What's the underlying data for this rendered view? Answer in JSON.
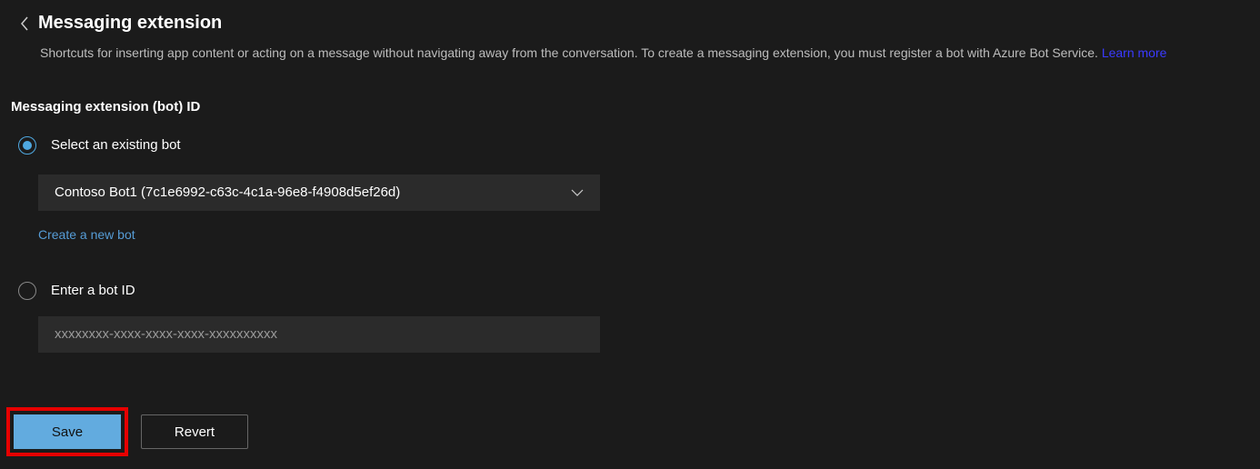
{
  "header": {
    "title": "Messaging extension",
    "description": "Shortcuts for inserting app content or acting on a message without navigating away from the conversation. To create a messaging extension, you must register a bot with Azure Bot Service.",
    "learn_more": "Learn more"
  },
  "section": {
    "label": "Messaging extension (bot) ID"
  },
  "option_existing": {
    "label": "Select an existing bot",
    "selected_value": "Contoso Bot1 (7c1e6992-c63c-4c1a-96e8-f4908d5ef26d)",
    "create_link": "Create a new bot"
  },
  "option_manual": {
    "label": "Enter a bot ID",
    "placeholder": "xxxxxxxx-xxxx-xxxx-xxxx-xxxxxxxxxx"
  },
  "buttons": {
    "save": "Save",
    "revert": "Revert"
  }
}
